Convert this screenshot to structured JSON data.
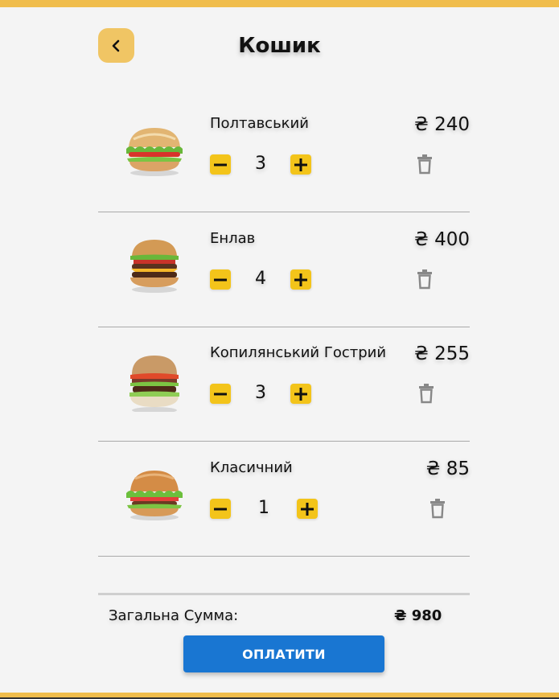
{
  "header": {
    "title": "Кошик",
    "back_icon": "chevron-left-icon"
  },
  "cart": {
    "items": [
      {
        "name": "Полтавський",
        "price": "₴ 240",
        "qty": "3",
        "image_icon": "burger-image"
      },
      {
        "name": "Енлав",
        "price": "₴ 400",
        "qty": "4",
        "image_icon": "burger-image"
      },
      {
        "name": "Копилянський Гострий",
        "price": "₴ 255",
        "qty": "3",
        "image_icon": "burger-image"
      },
      {
        "name": "Класичний",
        "price": "₴ 85",
        "qty": "1",
        "image_icon": "burger-image"
      }
    ],
    "decrement_icon": "minus-icon",
    "increment_icon": "plus-icon",
    "delete_icon": "trash-icon"
  },
  "summary": {
    "total_label": "Загальна Сумма:",
    "total_value": "₴ 980"
  },
  "actions": {
    "pay_label": "ОПЛАТИТИ"
  },
  "colors": {
    "accent": "#f0bd4c",
    "qty_button": "#f3c41a",
    "pay_button": "#1976d2",
    "trash": "#888888"
  }
}
